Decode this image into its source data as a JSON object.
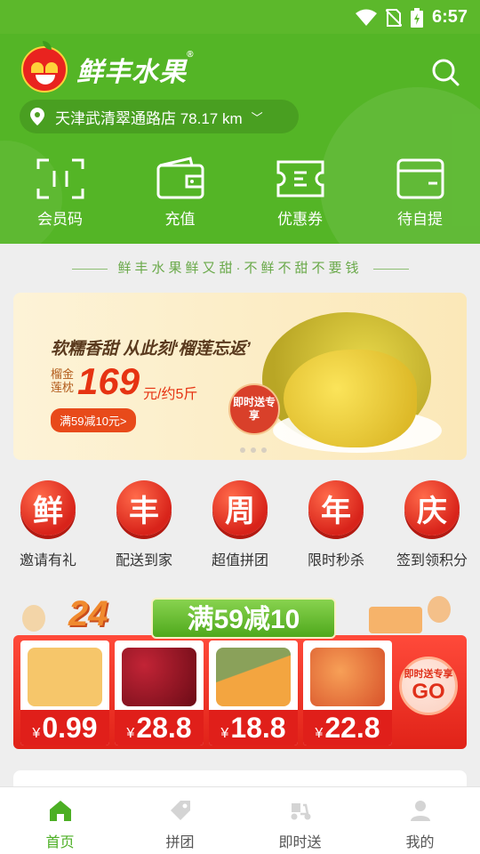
{
  "status_bar": {
    "time": "6:57"
  },
  "header": {
    "brand": "鲜丰水果",
    "brand_mark": "®",
    "store": "天津武清翠通路店 78.17 km",
    "quick_actions": [
      {
        "label": "会员码",
        "icon": "member-code-icon"
      },
      {
        "label": "充值",
        "icon": "wallet-icon"
      },
      {
        "label": "优惠券",
        "icon": "coupon-icon"
      },
      {
        "label": "待自提",
        "icon": "pickup-box-icon"
      }
    ]
  },
  "slogan": "鲜丰水果鲜又甜·不鲜不甜不要钱",
  "banner": {
    "headline": "软糯香甜 从此刻‘榴莲忘返’",
    "product": "榴金莲枕",
    "price": "169",
    "unit": "元/约5斤",
    "promo": "满59减10元>",
    "stamp": "即时送专享"
  },
  "features": [
    {
      "char": "鲜",
      "label": "邀请有礼"
    },
    {
      "char": "丰",
      "label": "配送到家"
    },
    {
      "char": "周",
      "label": "超值拼团"
    },
    {
      "char": "年",
      "label": "限时秒杀"
    },
    {
      "char": "庆",
      "label": "签到领积分"
    }
  ],
  "sale": {
    "badge": "24",
    "title": "满59减10",
    "currency": "¥",
    "items": [
      {
        "name": "melon-cubes",
        "price": "0.99",
        "color": "#f6c66a"
      },
      {
        "name": "cherries",
        "price": "28.8",
        "color": "#7a0f1a"
      },
      {
        "name": "hami-melon",
        "price": "18.8",
        "color": "#f3a540"
      },
      {
        "name": "peaches",
        "price": "22.8",
        "color": "#f07b3a"
      }
    ],
    "go_small": "即时送专享",
    "go_big": "GO"
  },
  "tabbar": [
    {
      "label": "首页",
      "icon": "home-icon",
      "active": true
    },
    {
      "label": "拼团",
      "icon": "tag-icon",
      "active": false
    },
    {
      "label": "即时送",
      "icon": "scooter-icon",
      "active": false
    },
    {
      "label": "我的",
      "icon": "user-icon",
      "active": false
    }
  ]
}
